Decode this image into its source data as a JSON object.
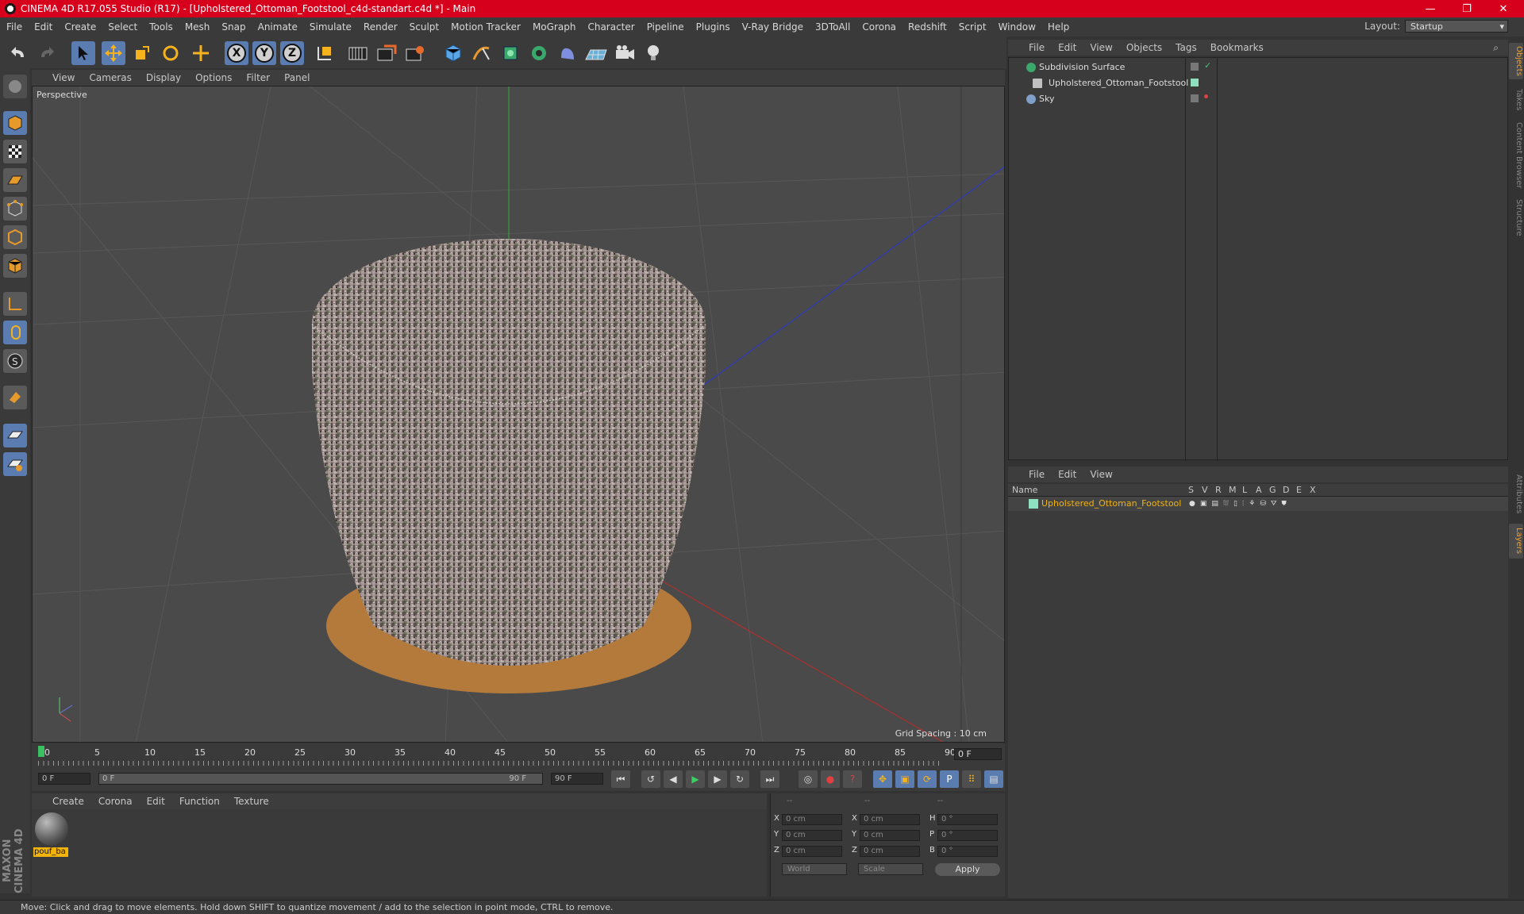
{
  "window": {
    "title": "CINEMA 4D R17.055 Studio (R17) - [Upholstered_Ottoman_Footstool_c4d-standart.c4d *] - Main",
    "controls": [
      "—",
      "❐",
      "✕"
    ]
  },
  "menu": [
    "File",
    "Edit",
    "Create",
    "Select",
    "Tools",
    "Mesh",
    "Snap",
    "Animate",
    "Simulate",
    "Render",
    "Sculpt",
    "Motion Tracker",
    "MoGraph",
    "Character",
    "Pipeline",
    "Plugins",
    "V-Ray Bridge",
    "3DToAll",
    "Corona",
    "Redshift",
    "Script",
    "Window",
    "Help"
  ],
  "layout": {
    "label": "Layout:",
    "value": "Startup"
  },
  "toolbar": {
    "axis_x": "X",
    "axis_y": "Y",
    "axis_z": "Z"
  },
  "viewport": {
    "menu": [
      "View",
      "Cameras",
      "Display",
      "Options",
      "Filter",
      "Panel"
    ],
    "label": "Perspective",
    "grid_spacing": "Grid Spacing : 10 cm",
    "object_name": "Upholstered_Ottoman_Footstool"
  },
  "timeline": {
    "ticks": [
      "0",
      "5",
      "10",
      "15",
      "20",
      "25",
      "30",
      "35",
      "40",
      "45",
      "50",
      "55",
      "60",
      "65",
      "70",
      "75",
      "80",
      "85",
      "90"
    ],
    "current_frame": "0 F",
    "start_field": "0 F",
    "range_start": "0 F",
    "range_end": "90 F",
    "end_field": "90 F"
  },
  "material_manager": {
    "menu": [
      "Create",
      "Corona",
      "Edit",
      "Function",
      "Texture"
    ],
    "materials": [
      {
        "name": "pouf_ba"
      }
    ]
  },
  "coordinates": {
    "header": [
      "--",
      "--",
      "--"
    ],
    "rows": [
      {
        "pos_label": "X",
        "pos": "0 cm",
        "size_label": "X",
        "size": "0 cm",
        "rot_label": "H",
        "rot": "0 °"
      },
      {
        "pos_label": "Y",
        "pos": "0 cm",
        "size_label": "Y",
        "size": "0 cm",
        "rot_label": "P",
        "rot": "0 °"
      },
      {
        "pos_label": "Z",
        "pos": "0 cm",
        "size_label": "Z",
        "size": "0 cm",
        "rot_label": "B",
        "rot": "0 °"
      }
    ],
    "mode": "World",
    "scale": "Scale",
    "apply": "Apply"
  },
  "object_manager": {
    "menu": [
      "File",
      "Edit",
      "View",
      "Objects",
      "Tags",
      "Bookmarks"
    ],
    "objects": [
      {
        "name": "Subdivision Surface",
        "icon_color": "#3aa86b"
      },
      {
        "name": "Upholstered_Ottoman_Footstool",
        "icon_color": "#c0c0c0"
      },
      {
        "name": "Sky",
        "icon_color": "#7f9ec8"
      }
    ]
  },
  "layer_manager": {
    "menu": [
      "File",
      "Edit",
      "View"
    ],
    "columns": [
      "Name",
      "S",
      "V",
      "R",
      "M",
      "L",
      "A",
      "G",
      "D",
      "E",
      "X"
    ],
    "layers": [
      {
        "name": "Upholstered_Ottoman_Footstool",
        "color": "#8fe0c0"
      }
    ]
  },
  "right_tabs": [
    "Objects",
    "Takes",
    "Content Browser",
    "Structure",
    "Attributes",
    "Layers"
  ],
  "status": "Move: Click and drag to move elements. Hold down SHIFT to quantize movement / add to the selection in point mode, CTRL to remove.",
  "colors": {
    "title_bar": "#d6001c",
    "accent": "#f2b30b",
    "active_tool": "#5b7cb0"
  }
}
